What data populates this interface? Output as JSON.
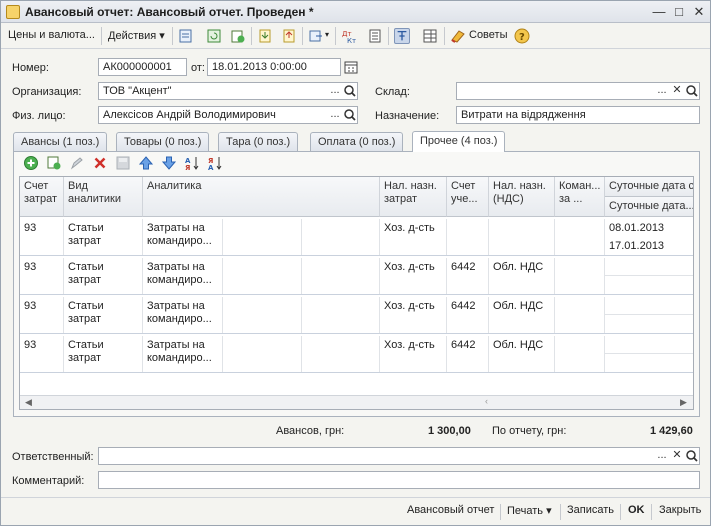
{
  "window": {
    "title": "Авансовый отчет: Авансовый отчет. Проведен *"
  },
  "toolbar": {
    "prices_currency": "Цены и валюта...",
    "actions": "Действия",
    "advice": "Советы"
  },
  "form": {
    "number_label": "Номер:",
    "number_value": "АК000000001",
    "date_label": "от:",
    "date_value": "18.01.2013  0:00:00",
    "org_label": "Организация:",
    "org_value": "ТОВ \"Акцент\"",
    "warehouse_label": "Склад:",
    "warehouse_value": "",
    "person_label": "Физ. лицо:",
    "person_value": "Алексiсов Андрiй Володимирович",
    "purpose_label": "Назначение:",
    "purpose_value": "Витрати на вiдрядження"
  },
  "tabs": [
    {
      "label": "Авансы (1 поз.)"
    },
    {
      "label": "Товары (0 поз.)"
    },
    {
      "label": "Тара (0 поз.)"
    },
    {
      "label": "Оплата (0 поз.)"
    },
    {
      "label": "Прочее (4 поз.)"
    }
  ],
  "grid": {
    "headers": {
      "account": "Счет затрат",
      "kind": "Вид аналитики",
      "analytics": "Аналитика",
      "tax_purpose": "Нал. назн. затрат",
      "account2": "Счет уче...",
      "tax_vat": "Нал. назн. (НДС)",
      "trip": "Коман... за ...",
      "per_diem_from": "Суточные дата с",
      "per_diem_to": "Суточные дата..."
    },
    "rows": [
      {
        "account": "93",
        "kind": "Статьи затрат",
        "analytics": "Затраты на командиро...",
        "tax_purpose": "Хоз. д-сть",
        "account2": "",
        "tax_vat": "",
        "date_from": "08.01.2013",
        "date_to": "17.01.2013"
      },
      {
        "account": "93",
        "kind": "Статьи затрат",
        "analytics": "Затраты на командиро...",
        "tax_purpose": "Хоз. д-сть",
        "account2": "6442",
        "tax_vat": "Обл. НДС",
        "date_from": "",
        "date_to": ""
      },
      {
        "account": "93",
        "kind": "Статьи затрат",
        "analytics": "Затраты на командиро...",
        "tax_purpose": "Хоз. д-сть",
        "account2": "6442",
        "tax_vat": "Обл. НДС",
        "date_from": "",
        "date_to": ""
      },
      {
        "account": "93",
        "kind": "Статьи затрат",
        "analytics": "Затраты на командиро...",
        "tax_purpose": "Хоз. д-сть",
        "account2": "6442",
        "tax_vat": "Обл. НДС",
        "date_from": "",
        "date_to": ""
      }
    ]
  },
  "totals": {
    "advances_label": "Авансов, грн:",
    "advances_value": "1 300,00",
    "report_label": "По отчету, грн:",
    "report_value": "1 429,60"
  },
  "responsible_label": "Ответственный:",
  "responsible_value": "",
  "comment_label": "Комментарий:",
  "comment_value": "",
  "bottom": {
    "report_btn": "Авансовый отчет",
    "print_btn": "Печать",
    "save_btn": "Записать",
    "ok_btn": "OK",
    "close_btn": "Закрыть"
  },
  "colors": {
    "accent": "#7f95b8",
    "tab_border": "#aab2bd",
    "field_border": "#a7adb6"
  }
}
